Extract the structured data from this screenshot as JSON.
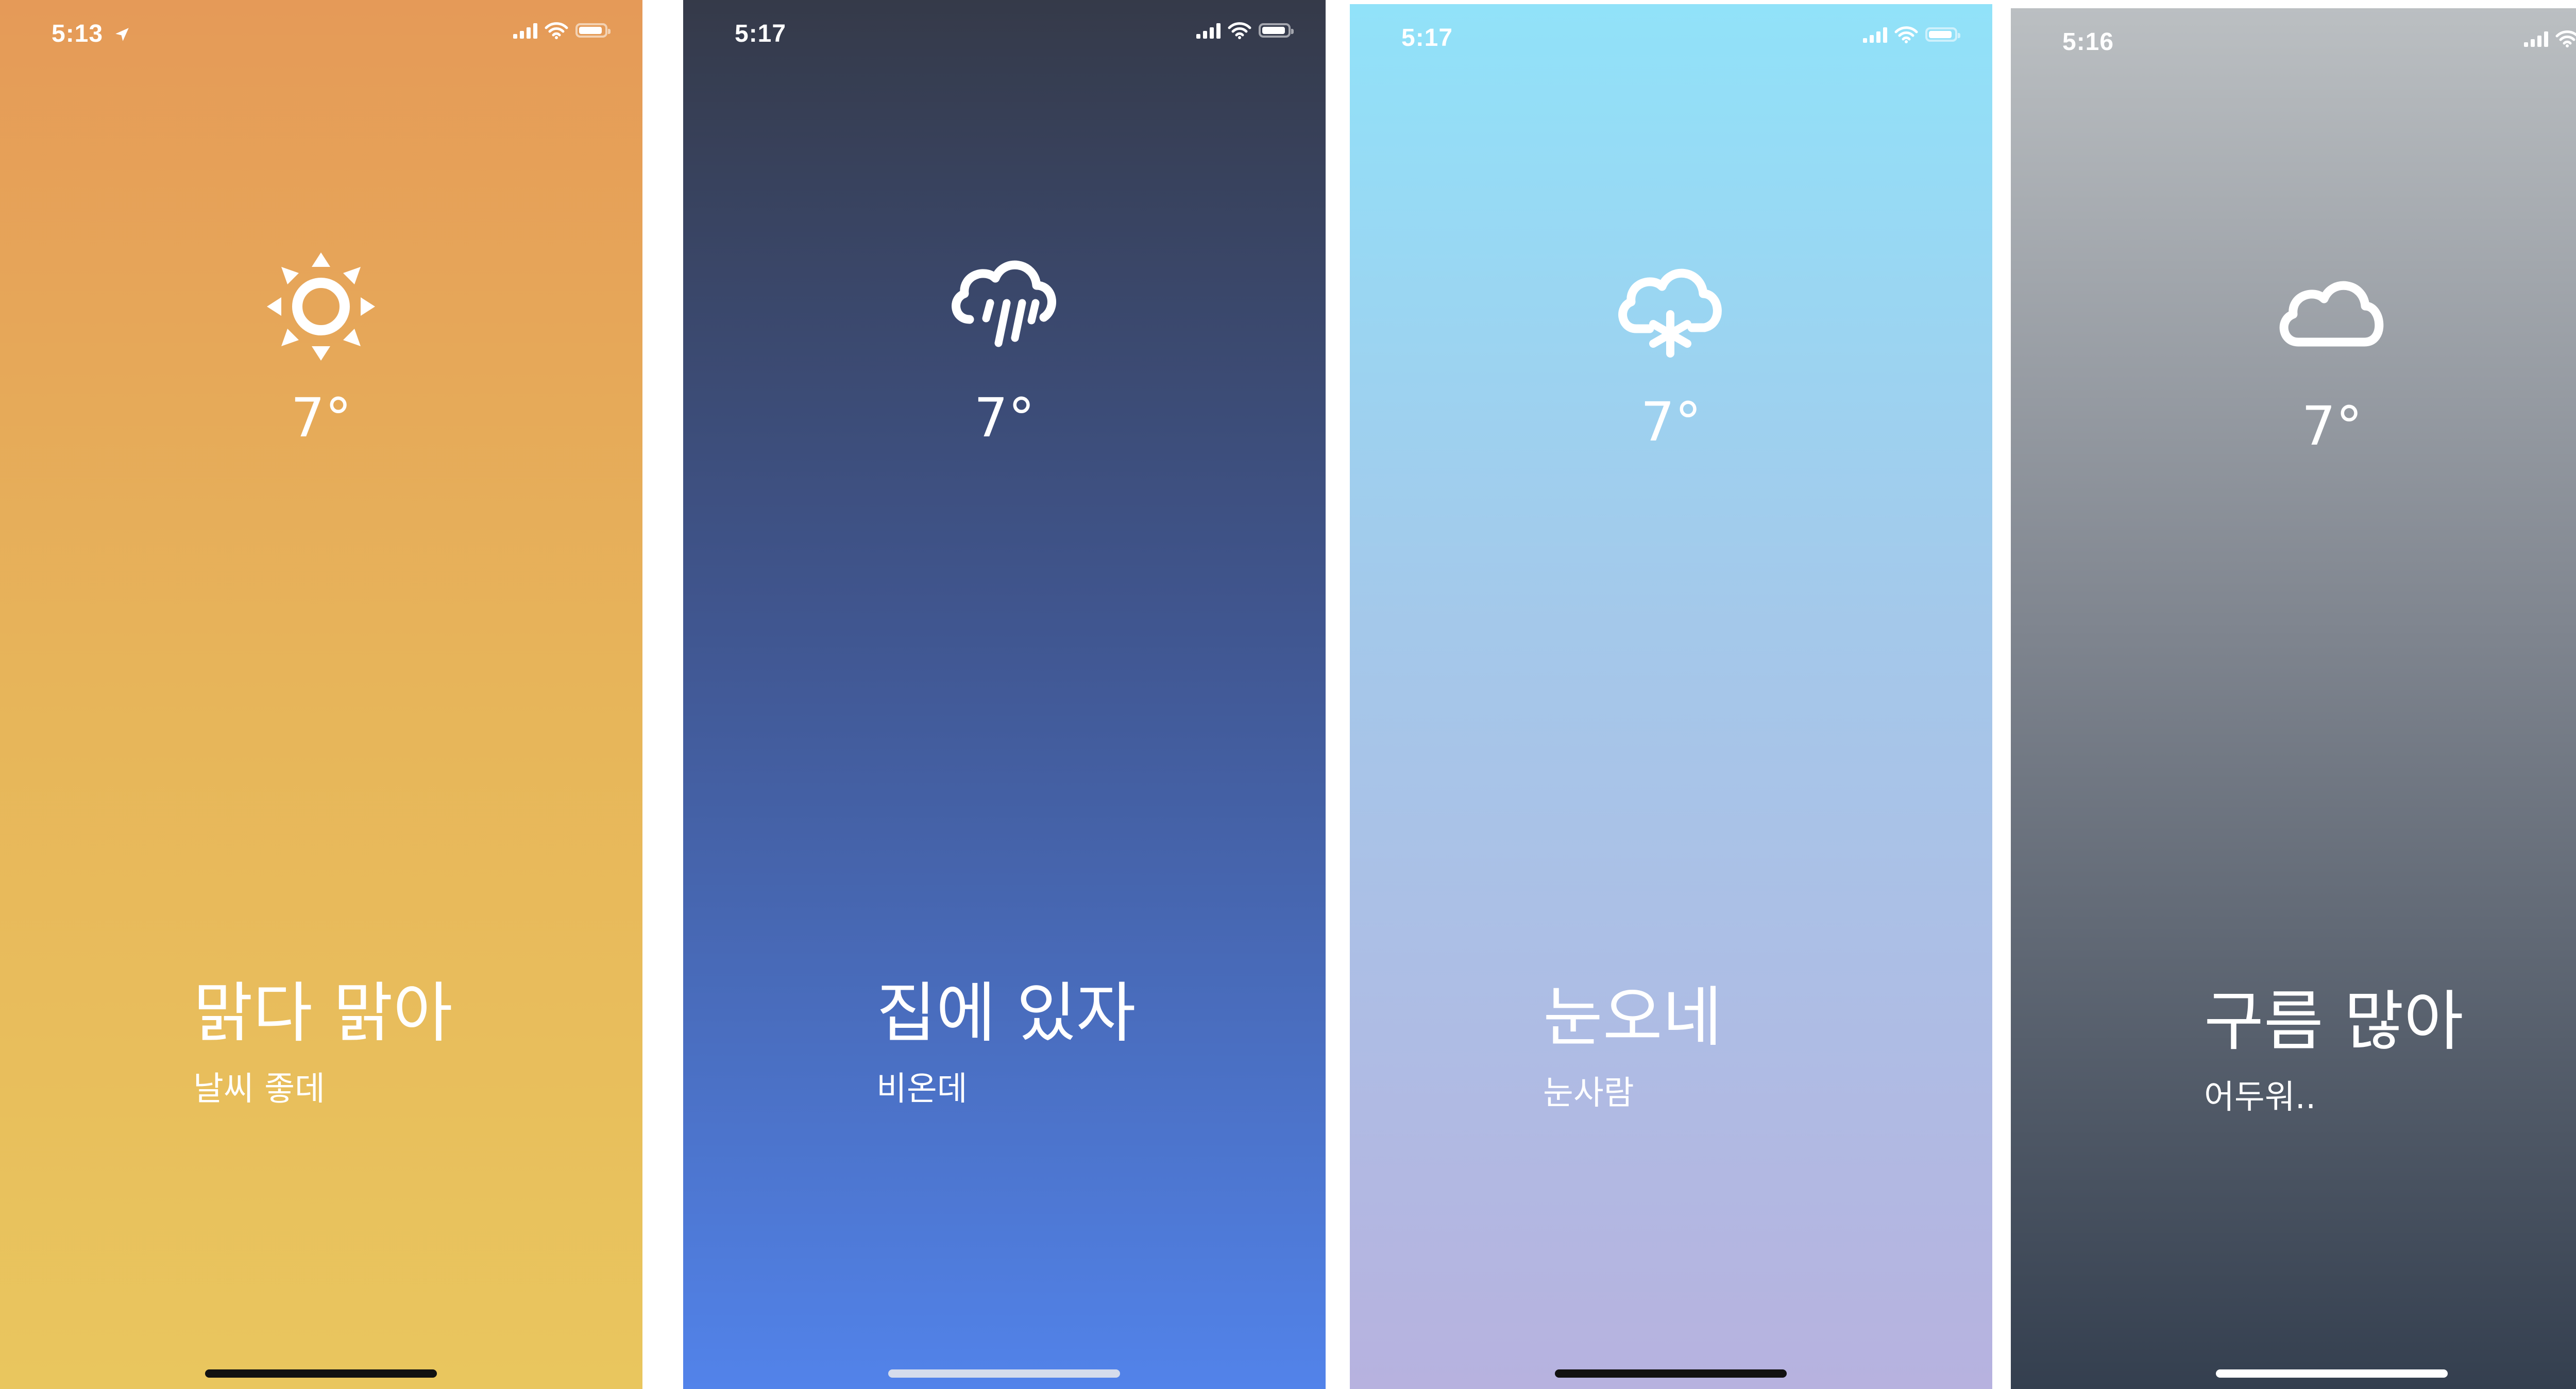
{
  "screens": [
    {
      "name": "sunny",
      "time": "5:13",
      "location_arrow": true,
      "icon": "sun-icon",
      "temperature": "7°",
      "title": "맑다 맑아",
      "subtitle": "날씨 좋데",
      "colors": {
        "top": "#E59A58",
        "bottom": "#E9C65E",
        "home_indicator": "#111111"
      }
    },
    {
      "name": "rain",
      "time": "5:17",
      "icon": "cloud-rain-icon",
      "temperature": "7°",
      "title": "집에 있자",
      "subtitle": "비온데",
      "colors": {
        "top": "#353A49",
        "bottom": "#5283EA",
        "home_indicator": "#D5DCEC"
      }
    },
    {
      "name": "snow",
      "time": "5:17",
      "icon": "cloud-snow-icon",
      "temperature": "7°",
      "title": "눈오네",
      "subtitle": "눈사람",
      "colors": {
        "top": "#91E2F9",
        "bottom": "#B7B2DF",
        "home_indicator": "#111111"
      }
    },
    {
      "name": "cloudy",
      "time": "5:16",
      "icon": "cloud-icon",
      "temperature": "7°",
      "title": "구름 많아",
      "subtitle": "어두워..",
      "colors": {
        "top": "#BBBFC2",
        "bottom": "#343F4F",
        "home_indicator": "#FFFFFF"
      }
    }
  ]
}
